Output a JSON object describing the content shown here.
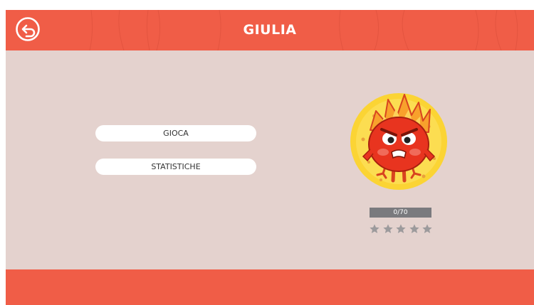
{
  "header": {
    "title": "GIULIA",
    "back_icon": "back-arrow-icon"
  },
  "menu": {
    "play_label": "GIOCA",
    "stats_label": "STATISTICHE"
  },
  "character": {
    "icon": "fire-monster-avatar",
    "progress": {
      "current": 0,
      "total": 70,
      "text": "0/70"
    },
    "rating": {
      "stars_filled": 0,
      "stars_total": 5
    }
  },
  "colors": {
    "accent": "#f05d47",
    "background": "#e4d2ce",
    "progress_track": "#7a7a7e",
    "star_empty": "#9c9a9c"
  }
}
